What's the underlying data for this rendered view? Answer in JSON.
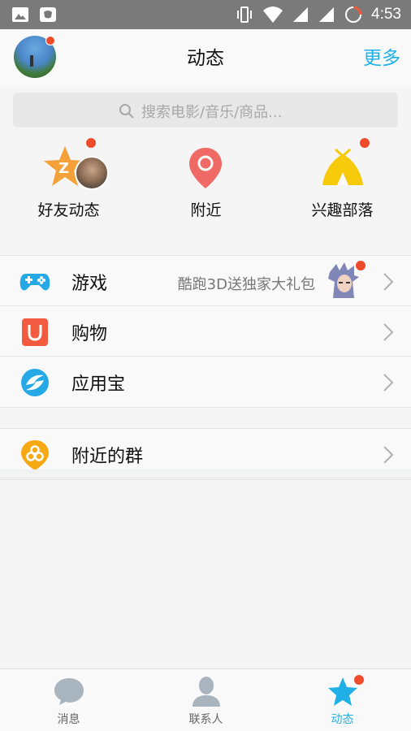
{
  "status_bar": {
    "time": "4:53"
  },
  "header": {
    "title": "动态",
    "more": "更多"
  },
  "search": {
    "placeholder": "搜索电影/音乐/商品..."
  },
  "quick_items": [
    {
      "label": "好友动态"
    },
    {
      "label": "附近"
    },
    {
      "label": "兴趣部落"
    }
  ],
  "list": [
    {
      "label": "游戏",
      "sub": "酷跑3D送独家大礼包"
    },
    {
      "label": "购物"
    },
    {
      "label": "应用宝"
    }
  ],
  "list2": [
    {
      "label": "附近的群"
    }
  ],
  "tabs": [
    {
      "label": "消息"
    },
    {
      "label": "联系人"
    },
    {
      "label": "动态"
    }
  ],
  "colors": {
    "accent": "#1fb0e8",
    "badge": "#ee4b2b",
    "star_orange": "#f5a13a",
    "pin_red": "#ef6a64",
    "tent_yellow": "#f6c90b"
  }
}
